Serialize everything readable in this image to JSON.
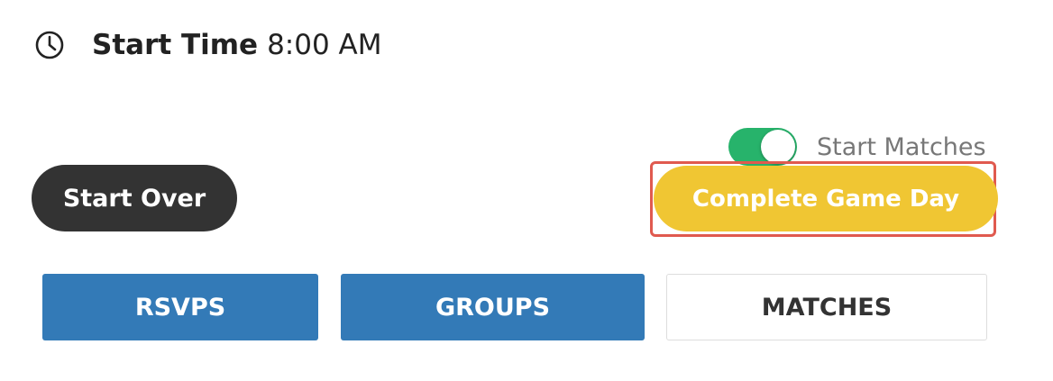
{
  "start_time": {
    "label": "Start Time",
    "value": "8:00 AM",
    "icon": "clock-icon"
  },
  "toggle": {
    "label": "Start Matches",
    "state": "on",
    "color": "#27b36b"
  },
  "buttons": {
    "start_over": "Start Over",
    "complete_game_day": "Complete Game Day"
  },
  "tabs": [
    {
      "label": "RSVPS",
      "active": true
    },
    {
      "label": "GROUPS",
      "active": true
    },
    {
      "label": "MATCHES",
      "active": false
    }
  ],
  "colors": {
    "start_over_bg": "#333333",
    "complete_bg": "#f0c633",
    "highlight_outline": "#e05a4f",
    "tab_active_bg": "#337ab7"
  }
}
